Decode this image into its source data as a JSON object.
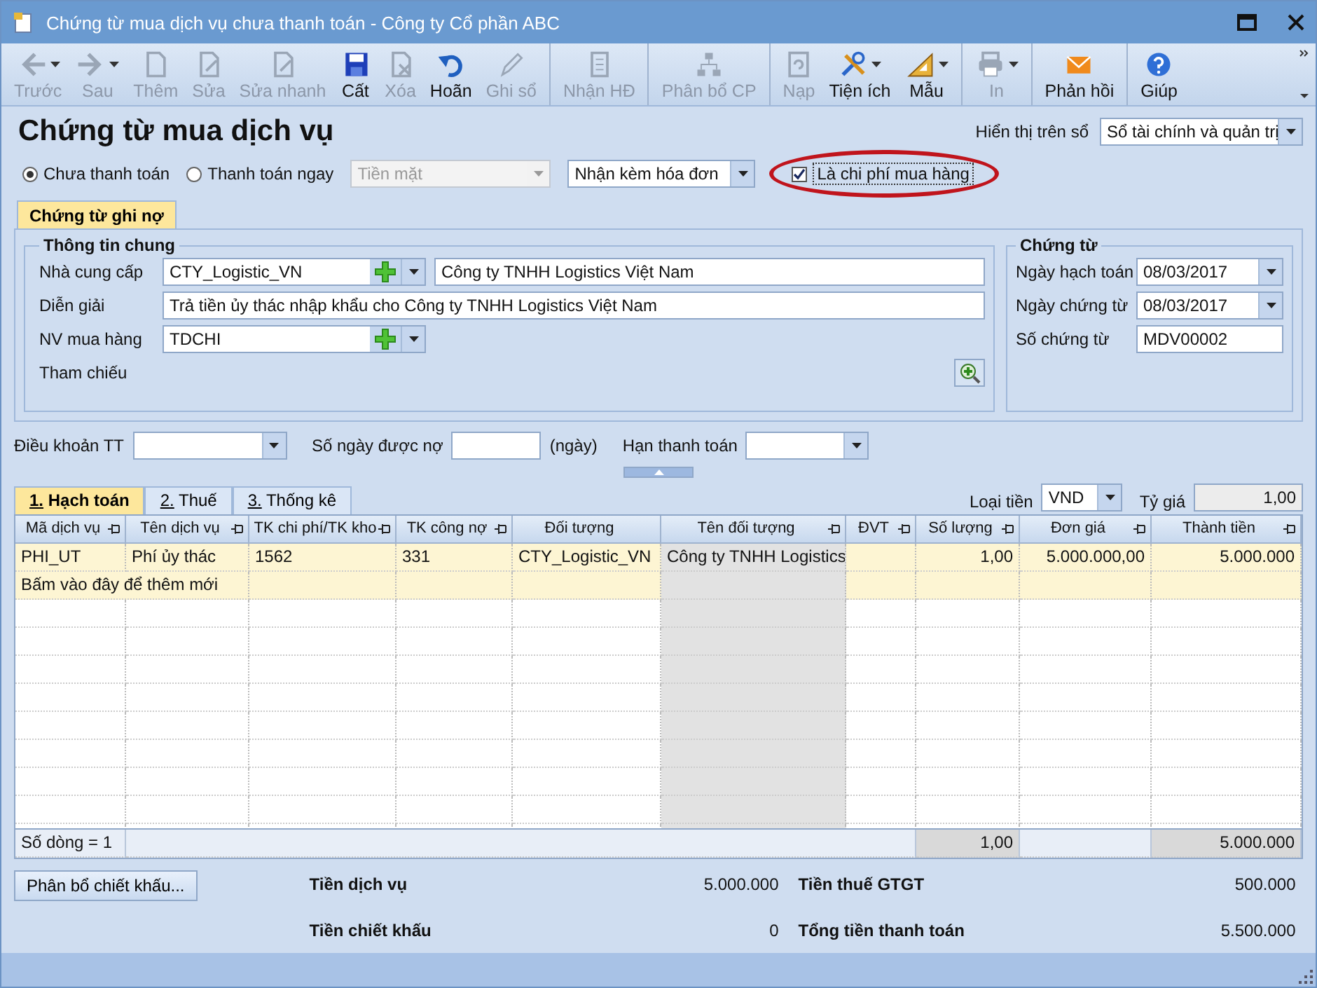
{
  "window": {
    "title": "Chứng từ mua dịch vụ chưa thanh toán - Công ty Cổ phần ABC"
  },
  "toolbar": [
    {
      "label": "Trước",
      "disabled": true,
      "dropdown": true,
      "separator": false
    },
    {
      "label": "Sau",
      "disabled": true,
      "dropdown": true,
      "separator": false
    },
    {
      "label": "Thêm",
      "disabled": true,
      "dropdown": false,
      "separator": false
    },
    {
      "label": "Sửa",
      "disabled": true,
      "dropdown": false,
      "separator": false
    },
    {
      "label": "Sửa nhanh",
      "disabled": true,
      "dropdown": false,
      "separator": false
    },
    {
      "label": "Cất",
      "disabled": false,
      "dropdown": false,
      "separator": false
    },
    {
      "label": "Xóa",
      "disabled": true,
      "dropdown": false,
      "separator": false
    },
    {
      "label": "Hoãn",
      "disabled": false,
      "dropdown": false,
      "separator": false
    },
    {
      "label": "Ghi sổ",
      "disabled": true,
      "dropdown": false,
      "separator": false
    },
    {
      "label": "Nhận HĐ",
      "disabled": true,
      "dropdown": false,
      "separator": true
    },
    {
      "label": "Phân bổ CP",
      "disabled": true,
      "dropdown": false,
      "separator": true
    },
    {
      "label": "Nạp",
      "disabled": true,
      "dropdown": false,
      "separator": true
    },
    {
      "label": "Tiện ích",
      "disabled": false,
      "dropdown": true,
      "separator": false
    },
    {
      "label": "Mẫu",
      "disabled": false,
      "dropdown": true,
      "separator": false
    },
    {
      "label": "In",
      "disabled": true,
      "dropdown": true,
      "separator": true
    },
    {
      "label": "Phản hồi",
      "disabled": false,
      "dropdown": false,
      "separator": true
    },
    {
      "label": "Giúp",
      "disabled": false,
      "dropdown": false,
      "separator": true
    }
  ],
  "header": {
    "title": "Chứng từ mua dịch vụ",
    "display_label": "Hiển thị trên sổ",
    "display_value": "Sổ tài chính và quản trị"
  },
  "payment": {
    "options": [
      {
        "label": "Chưa thanh toán",
        "selected": true
      },
      {
        "label": "Thanh toán ngay",
        "selected": false
      }
    ],
    "method": {
      "value": "Tiền mặt",
      "disabled": true
    },
    "invoice": {
      "value": "Nhận kèm hóa đơn"
    },
    "purchase_cost": {
      "label": "Là chi phí mua hàng",
      "checked": true,
      "circled": true
    }
  },
  "form_tab": {
    "label": "Chứng từ ghi nợ",
    "selected": true
  },
  "general": {
    "title": "Thông tin chung",
    "supplier_label": "Nhà cung cấp",
    "supplier_code": "CTY_Logistic_VN",
    "supplier_name": "Công ty TNHH Logistics Việt Nam",
    "description_label": "Diễn giải",
    "description": "Trả tiền ủy thác nhập khẩu cho Công ty TNHH Logistics Việt Nam",
    "buyer_label": "NV mua hàng",
    "buyer": "TDCHI",
    "reference_label": "Tham chiếu"
  },
  "voucher": {
    "title": "Chứng từ",
    "fields": [
      {
        "label": "Ngày hạch toán",
        "value": "08/03/2017",
        "kind": "date"
      },
      {
        "label": "Ngày chứng từ",
        "value": "08/03/2017",
        "kind": "date"
      },
      {
        "label": "Số chứng từ",
        "value": "MDV00002",
        "kind": "text"
      }
    ]
  },
  "terms": {
    "terms_label": "Điều khoản TT",
    "days_label": "Số ngày được nợ",
    "days_unit": "(ngày)",
    "due_label": "Hạn thanh toán"
  },
  "grid_tabs": [
    {
      "number": "1.",
      "label": "Hạch toán",
      "selected": true
    },
    {
      "number": "2.",
      "label": "Thuế",
      "selected": false
    },
    {
      "number": "3.",
      "label": "Thống kê",
      "selected": false
    }
  ],
  "currency": {
    "label": "Loại tiền",
    "value": "VND",
    "rate_label": "Tỷ giá",
    "rate": "1,00"
  },
  "table": {
    "columns": [
      {
        "label": "Mã dịch vụ",
        "pinned": true,
        "readonly": false
      },
      {
        "label": "Tên dịch vụ",
        "pinned": true,
        "readonly": false
      },
      {
        "label": "TK chi phí/TK kho",
        "pinned": true,
        "readonly": false
      },
      {
        "label": "TK công nợ",
        "pinned": true,
        "readonly": false
      },
      {
        "label": "Đối tượng",
        "pinned": false,
        "readonly": false
      },
      {
        "label": "Tên đối tượng",
        "pinned": true,
        "readonly": true
      },
      {
        "label": "ĐVT",
        "pinned": true,
        "readonly": false
      },
      {
        "label": "Số lượng",
        "pinned": true,
        "readonly": false
      },
      {
        "label": "Đơn giá",
        "pinned": true,
        "readonly": false
      },
      {
        "label": "Thành tiền",
        "pinned": true,
        "readonly": false
      }
    ],
    "rows": [
      [
        "PHI_UT",
        "Phí ủy thác",
        "1562",
        "331",
        "CTY_Logistic_VN",
        "Công ty TNHH Logistics",
        "",
        "1,00",
        "5.000.000,00",
        "5.000.000"
      ]
    ],
    "new_row": "Bấm vào đây để thêm mới",
    "footer": {
      "count": "Số dòng = 1",
      "quantity": "1,00",
      "amount": "5.000.000"
    }
  },
  "discount_button": "Phân bổ chiết khấu...",
  "totals": [
    {
      "label": "Tiền dịch vụ",
      "value": "5.000.000"
    },
    {
      "label": "Tiền thuế GTGT",
      "value": "500.000"
    },
    {
      "label": "Tiền chiết khấu",
      "value": "0"
    },
    {
      "label": "Tổng tiền thanh toán",
      "value": "5.500.000"
    }
  ]
}
